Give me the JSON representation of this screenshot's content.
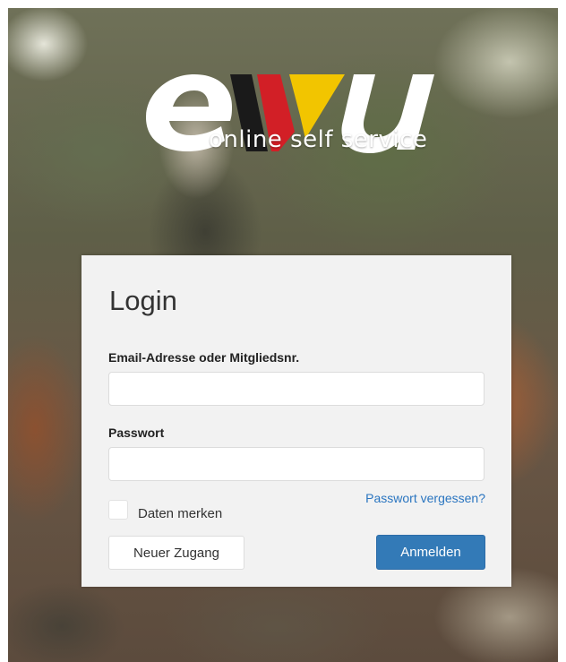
{
  "logo": {
    "brand": "ewu",
    "tagline": "online self service",
    "colors": {
      "white": "#ffffff",
      "black": "#1a1a1a",
      "red": "#d21f26",
      "gold": "#f2c500"
    }
  },
  "login": {
    "title": "Login",
    "email_label": "Email-Adresse oder Mitgliedsnr.",
    "email_value": "",
    "password_label": "Passwort",
    "password_value": "",
    "forgot_link": "Passwort vergessen?",
    "remember_label": "Daten merken",
    "remember_checked": false,
    "new_account_button": "Neuer Zugang",
    "submit_button": "Anmelden"
  },
  "colors": {
    "accent": "#337ab7",
    "link": "#2a75c0",
    "card_background": "#f2f2f2"
  }
}
